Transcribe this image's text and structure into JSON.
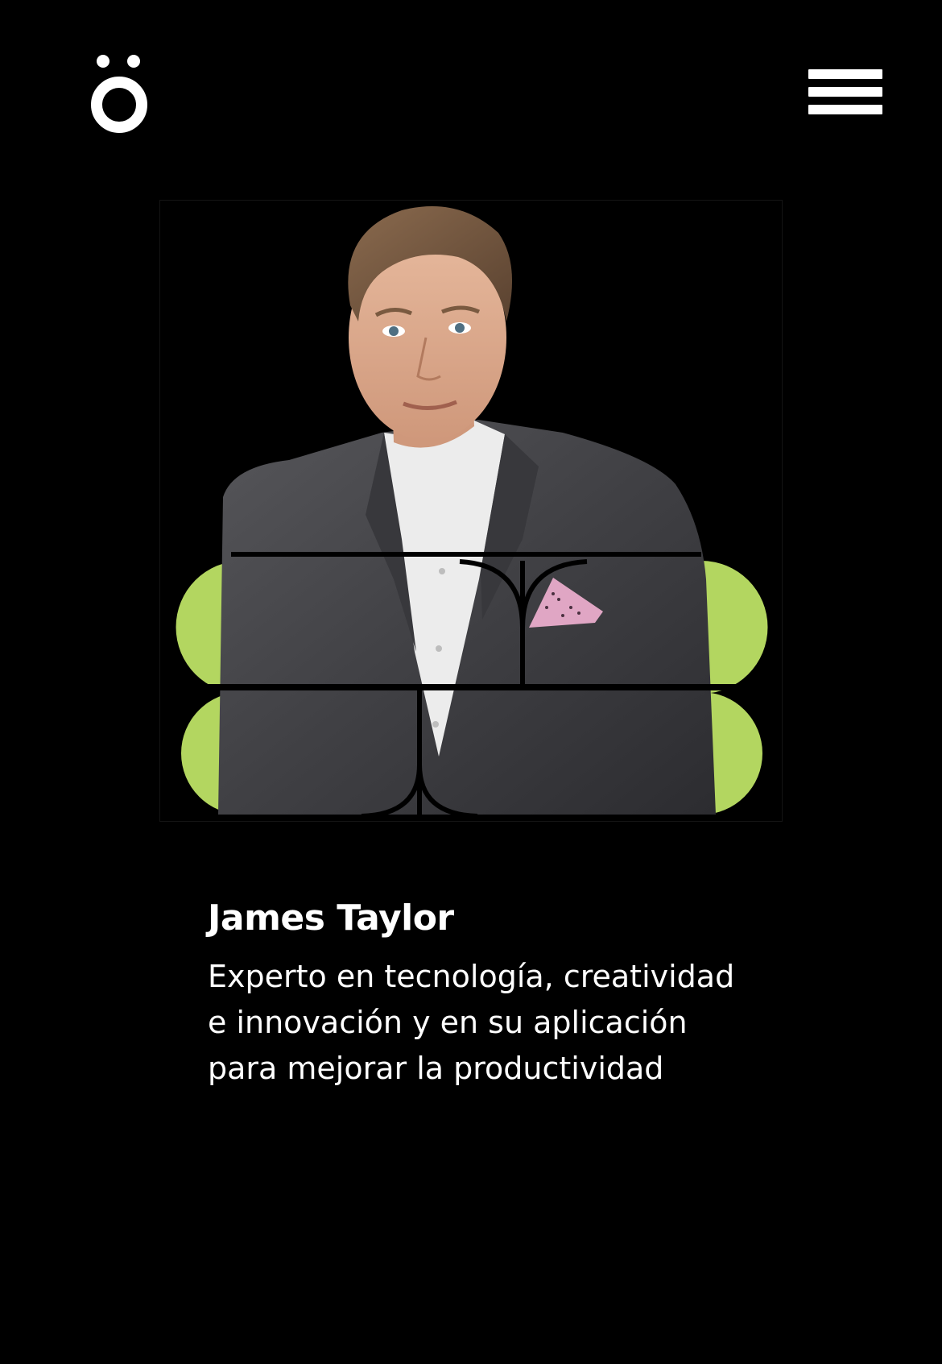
{
  "header": {
    "logo_icon": "o-umlaut-logo-icon",
    "menu_icon": "hamburger-menu-icon"
  },
  "speaker": {
    "name": "James Taylor",
    "description": "Experto en tecnología, creatividad e innovación y en su aplicación para mejorar la productividad",
    "photo": "speaker-portrait",
    "accent_color": "#b3d660"
  },
  "colors": {
    "background": "#000000",
    "text": "#ffffff",
    "accent": "#b3d660"
  }
}
